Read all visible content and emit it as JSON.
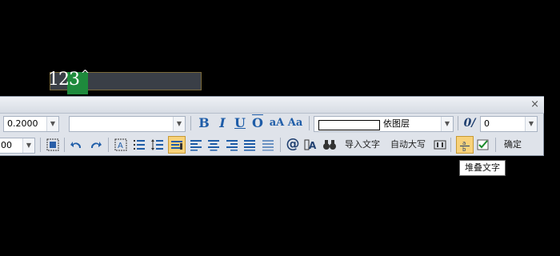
{
  "canvas_text": "123",
  "toolbar": {
    "close_glyph": "×",
    "row1": {
      "height_value": "0.2000",
      "font_value": "",
      "bold": "B",
      "italic": "I",
      "underline": "U",
      "overline": "O",
      "upper_lower": "aA",
      "sub_super": "Aa",
      "color_label": "依图层",
      "oblique_icon_text": "0/",
      "oblique_value": "0"
    },
    "row2": {
      "left_value": "00",
      "at_symbol": "@",
      "import_text": "导入文字",
      "auto_upper": "自动大写",
      "confirm": "确定"
    },
    "stack_tooltip": "堆叠文字"
  }
}
